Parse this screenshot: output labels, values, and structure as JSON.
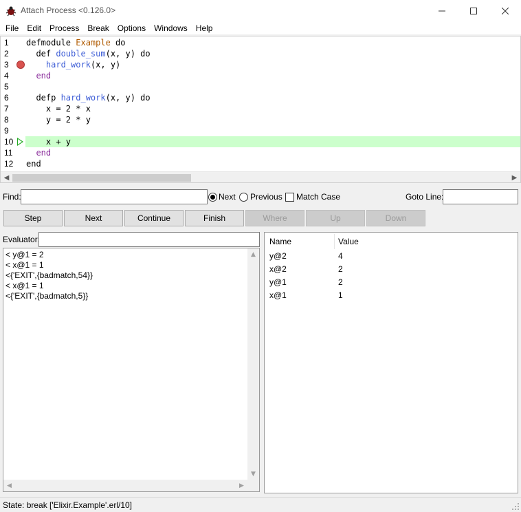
{
  "window": {
    "title": "Attach Process <0.126.0>"
  },
  "menu": [
    "File",
    "Edit",
    "Process",
    "Break",
    "Options",
    "Windows",
    "Help"
  ],
  "code": {
    "lines": [
      {
        "no": "1",
        "parts": [
          [
            "kw",
            "defmodule "
          ],
          [
            "mod",
            "Example"
          ],
          [
            "kw",
            " do"
          ]
        ]
      },
      {
        "no": "2",
        "parts": [
          [
            "kw",
            "  def "
          ],
          [
            "fn",
            "double_sum"
          ],
          [
            "kw",
            "(x, y) do"
          ]
        ]
      },
      {
        "no": "3",
        "parts": [
          [
            "kw",
            "    "
          ],
          [
            "fn",
            "hard_work"
          ],
          [
            "kw",
            "(x, y)"
          ]
        ],
        "breakpoint": true
      },
      {
        "no": "4",
        "parts": [
          [
            "end",
            "  end"
          ]
        ]
      },
      {
        "no": "5",
        "parts": []
      },
      {
        "no": "6",
        "parts": [
          [
            "kw",
            "  defp "
          ],
          [
            "fn",
            "hard_work"
          ],
          [
            "kw",
            "(x, y) do"
          ]
        ]
      },
      {
        "no": "7",
        "parts": [
          [
            "kw",
            "    x = 2 * x"
          ]
        ]
      },
      {
        "no": "8",
        "parts": [
          [
            "kw",
            "    y = 2 * y"
          ]
        ]
      },
      {
        "no": "9",
        "parts": []
      },
      {
        "no": "10",
        "parts": [
          [
            "kw",
            "    x + y"
          ]
        ],
        "current": true
      },
      {
        "no": "11",
        "parts": [
          [
            "end",
            "  end"
          ]
        ]
      },
      {
        "no": "12",
        "parts": [
          [
            "kw",
            "end"
          ]
        ]
      }
    ]
  },
  "find": {
    "label": "Find:",
    "value": "",
    "next_label": "Next",
    "previous_label": "Previous",
    "match_case_label": "Match Case",
    "goto_label": "Goto Line:",
    "goto_value": ""
  },
  "buttons": {
    "step": "Step",
    "next": "Next",
    "continue": "Continue",
    "finish": "Finish",
    "where": "Where",
    "up": "Up",
    "down": "Down"
  },
  "evaluator": {
    "label": "Evaluator:",
    "value": "",
    "output": [
      "< y@1 = 2",
      "< x@1 = 1",
      "<{'EXIT',{badmatch,54}}",
      "< x@1 = 1",
      "<{'EXIT',{badmatch,5}}"
    ]
  },
  "bindings": {
    "columns": [
      "Name",
      "Value"
    ],
    "rows": [
      {
        "name": "y@2",
        "value": "4"
      },
      {
        "name": "x@2",
        "value": "2"
      },
      {
        "name": "y@1",
        "value": "2"
      },
      {
        "name": "x@1",
        "value": "1"
      }
    ]
  },
  "status": {
    "text": "State: break ['Elixir.Example'.erl/10]"
  },
  "colors": {
    "current_line": "#ccffcc",
    "breakpoint": "#d9534f",
    "function_name": "#3c5cd6",
    "module_name": "#b05a00",
    "end_keyword": "#8a2d9b"
  }
}
